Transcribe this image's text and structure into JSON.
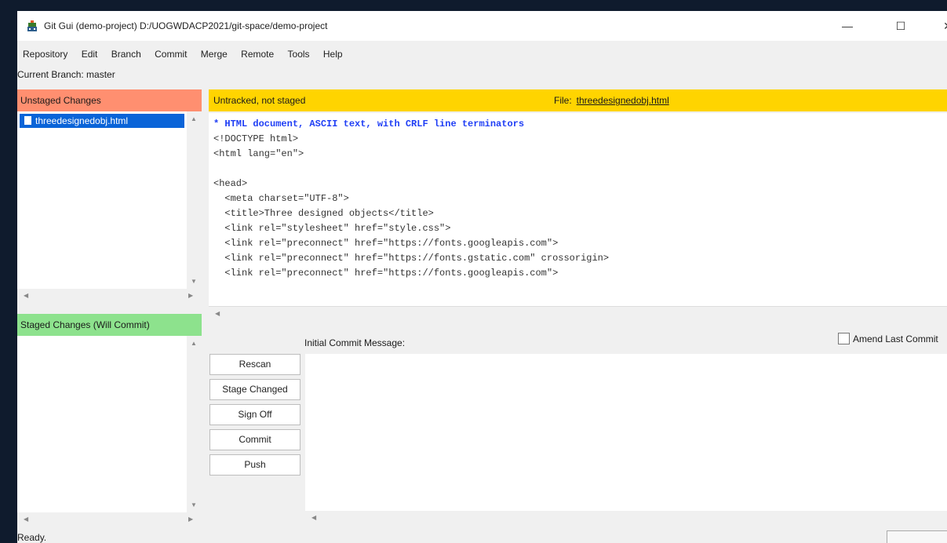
{
  "window": {
    "title": "Git Gui (demo-project) D:/UOGWDACP2021/git-space/demo-project",
    "minimize": "—",
    "maximize": "☐",
    "close": "✕"
  },
  "menu": [
    "Repository",
    "Edit",
    "Branch",
    "Commit",
    "Merge",
    "Remote",
    "Tools",
    "Help"
  ],
  "branch": "Current Branch: master",
  "unstaged": {
    "header": "Unstaged Changes",
    "files": [
      "threedesignedobj.html"
    ]
  },
  "staged": {
    "header": "Staged Changes (Will Commit)"
  },
  "diff": {
    "status": "Untracked, not staged",
    "file_label": "File:",
    "file_name": "threedesignedobj.html",
    "lines": [
      "* HTML document, ASCII text, with CRLF line terminators",
      "<!DOCTYPE html>",
      "<html lang=\"en\">",
      "",
      "<head>",
      "  <meta charset=\"UTF-8\">",
      "  <title>Three designed objects</title>",
      "  <link rel=\"stylesheet\" href=\"style.css\">",
      "  <link rel=\"preconnect\" href=\"https://fonts.googleapis.com\">",
      "  <link rel=\"preconnect\" href=\"https://fonts.gstatic.com\" crossorigin>",
      "  <link rel=\"preconnect\" href=\"https://fonts.googleapis.com\">"
    ]
  },
  "commit": {
    "label": "Initial Commit Message:",
    "amend_label": "Amend Last Commit",
    "buttons": [
      "Rescan",
      "Stage Changed",
      "Sign Off",
      "Commit",
      "Push"
    ]
  },
  "status": "Ready."
}
